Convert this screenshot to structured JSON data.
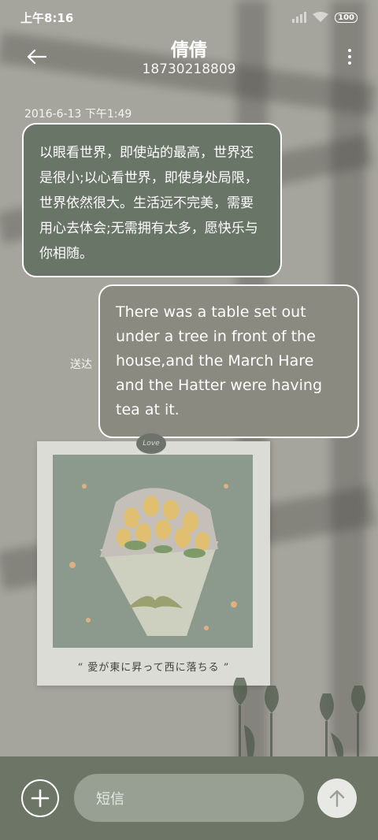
{
  "status_bar": {
    "time": "上午8:16",
    "battery": "100"
  },
  "header": {
    "contact_name": "倩倩",
    "phone_number": "18730218809"
  },
  "conversation": {
    "timestamp": "2016-6-13 下午1:49",
    "received_message": "以眼看世界，即使站的最高，世界还是很小;以心看世界，即使身处局限，世界依然很大。生活远不完美，需要用心去体会;无需拥有太多，愿快乐与你相随。",
    "sent_message": "There was a table set out under a tree in front of the house,and the March Hare and the Hatter were having tea at it.",
    "delivery_status": "送达"
  },
  "wallpaper": {
    "photo_caption": "“ 愛が東に昇って西に落ちる ”",
    "love_tag": "Love"
  },
  "composer": {
    "placeholder": "短信"
  },
  "colors": {
    "received_bubble": "#697566",
    "sent_bubble": "#8a8a80",
    "composer_bar": "#6c7566"
  },
  "icons": {
    "back": "arrow-left-icon",
    "more": "more-vertical-icon",
    "add": "plus-circle-icon",
    "send": "arrow-up-icon"
  }
}
